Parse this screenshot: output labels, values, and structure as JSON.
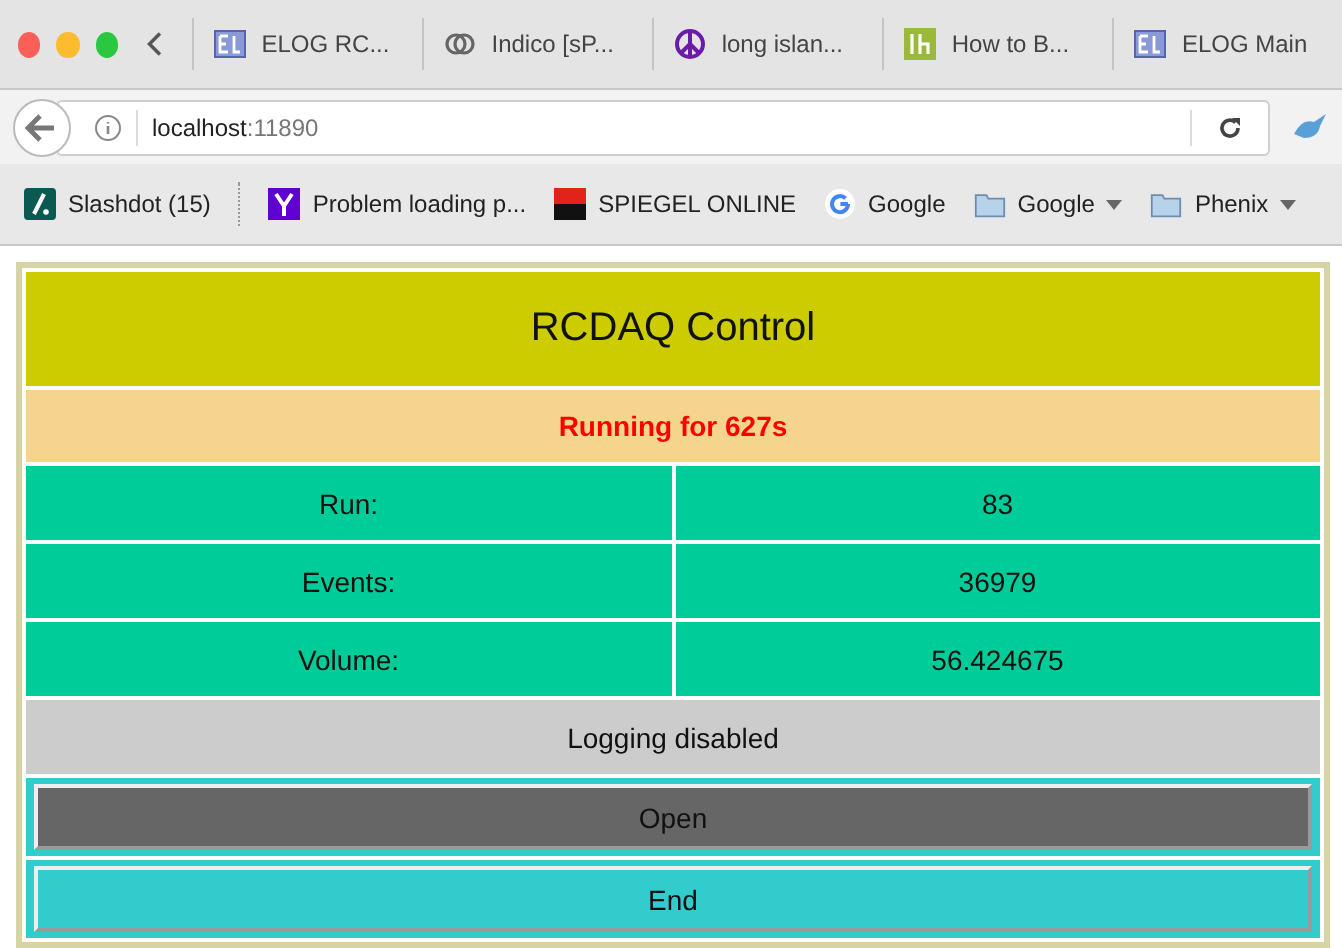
{
  "tabs": [
    {
      "label": "ELOG RC...",
      "kind": "elog",
      "selected": false
    },
    {
      "label": "Indico [sP...",
      "kind": "indico",
      "selected": false
    },
    {
      "label": "long islan...",
      "kind": "peace",
      "selected": false
    },
    {
      "label": "How to B...",
      "kind": "lh",
      "selected": false
    },
    {
      "label": "ELOG Main",
      "kind": "elog",
      "selected": false
    }
  ],
  "address": {
    "host": "localhost",
    "port": ":11890"
  },
  "bookmarks": [
    {
      "label": "Slashdot (15)",
      "kind": "slashdot"
    },
    {
      "label": "Problem loading p...",
      "kind": "yahoo"
    },
    {
      "label": "SPIEGEL ONLINE",
      "kind": "spiegel"
    },
    {
      "label": "Google",
      "kind": "google"
    },
    {
      "label": "Google",
      "kind": "folder"
    },
    {
      "label": "Phenix",
      "kind": "folder"
    }
  ],
  "page": {
    "title": "RCDAQ Control",
    "status": "Running for 627s",
    "rows": [
      {
        "label": "Run:",
        "value": "83"
      },
      {
        "label": "Events:",
        "value": "36979"
      },
      {
        "label": "Volume:",
        "value": "56.424675"
      }
    ],
    "logging": "Logging disabled",
    "buttons": [
      {
        "label": "Open",
        "color": "#666666"
      },
      {
        "label": "End",
        "color": "#33cccc"
      }
    ]
  }
}
